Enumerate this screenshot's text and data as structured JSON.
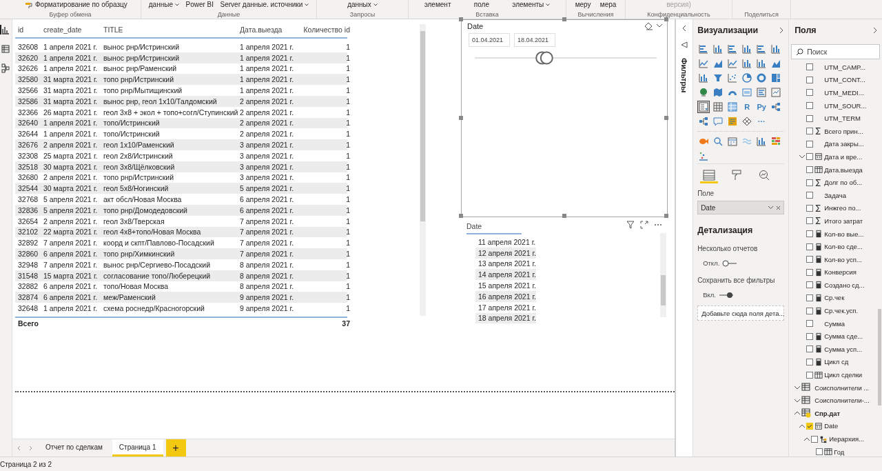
{
  "ribbon": {
    "groups": [
      {
        "label": "Буфер обмена",
        "items": [
          {
            "text": "Форматирование по образцу",
            "kind": "brush",
            "caret": false,
            "disabled": false
          }
        ]
      },
      {
        "label": "Данные",
        "items": [
          {
            "text": "данные",
            "kind": "text",
            "caret": true,
            "disabled": false
          },
          {
            "text": "Power BI",
            "kind": "text",
            "caret": false,
            "disabled": false
          },
          {
            "text": "Server данные. источники",
            "kind": "text",
            "caret": true,
            "disabled": false
          }
        ]
      },
      {
        "label": "Запросы",
        "items": [
          {
            "text": "данных",
            "kind": "text",
            "caret": true,
            "disabled": false
          }
        ]
      },
      {
        "label": "Вставка",
        "items": [
          {
            "text": "элемент",
            "kind": "text",
            "caret": false,
            "disabled": false
          },
          {
            "text": "поле",
            "kind": "text",
            "caret": false,
            "disabled": false
          },
          {
            "text": "элементы",
            "kind": "text",
            "caret": true,
            "disabled": false
          }
        ]
      },
      {
        "label": "Вычисления",
        "items": [
          {
            "text": "меру",
            "kind": "text",
            "caret": false,
            "disabled": false
          },
          {
            "text": "мера",
            "kind": "text",
            "caret": false,
            "disabled": false
          }
        ]
      },
      {
        "label": "Конфиденциальность",
        "items": [
          {
            "text": "версия)",
            "kind": "text",
            "caret": false,
            "disabled": true
          }
        ]
      },
      {
        "label": "Поделиться"
      }
    ]
  },
  "views": [
    {
      "kind": "report",
      "selected": true
    },
    {
      "kind": "data",
      "selected": false
    },
    {
      "kind": "model",
      "selected": false
    }
  ],
  "table": {
    "columns": [
      "id",
      "create_date",
      "TITLE",
      "Дата.выезда",
      "Количество id"
    ],
    "rows": [
      [
        "32608",
        "1 апреля 2021 г.",
        "вынос рнр/Истринский",
        "1 апреля 2021 г.",
        "1"
      ],
      [
        "32620",
        "1 апреля 2021 г.",
        "вынос рнр/Истринский",
        "1 апреля 2021 г.",
        "1"
      ],
      [
        "32626",
        "1 апреля 2021 г.",
        "вынос рнр/Раменский",
        "1 апреля 2021 г.",
        "1"
      ],
      [
        "32580",
        "31 марта 2021 г.",
        "топо рнр/Истринский",
        "1 апреля 2021 г.",
        "1"
      ],
      [
        "32566",
        "31 марта 2021 г.",
        "топо рнр/Мытищинский",
        "1 апреля 2021 г.",
        "1"
      ],
      [
        "32586",
        "31 марта 2021 г.",
        "вынос рнр, геол 1х10/Талдомский",
        "2 апреля 2021 г.",
        "1"
      ],
      [
        "32366",
        "26 марта 2021 г.",
        "геол 3х8 + экол + топо+согл/Ступинский",
        "2 апреля 2021 г.",
        "1"
      ],
      [
        "32640",
        "1 апреля 2021 г.",
        "топо/Истринский",
        "2 апреля 2021 г.",
        "1"
      ],
      [
        "32644",
        "1 апреля 2021 г.",
        "топо/Истринский",
        "2 апреля 2021 г.",
        "1"
      ],
      [
        "32676",
        "2 апреля 2021 г.",
        "геол 1х10/Раменский",
        "3 апреля 2021 г.",
        "1"
      ],
      [
        "32308",
        "25 марта 2021 г.",
        "геол 2х8/Истринский",
        "3 апреля 2021 г.",
        "1"
      ],
      [
        "32518",
        "30 марта 2021 г.",
        "геол 3х8/Щёлковский",
        "3 апреля 2021 г.",
        "1"
      ],
      [
        "32680",
        "2 апреля 2021 г.",
        "топо рнр/Истринский",
        "3 апреля 2021 г.",
        "1"
      ],
      [
        "32544",
        "30 марта 2021 г.",
        "геол 5х8/Ногинский",
        "5 апреля 2021 г.",
        "1"
      ],
      [
        "32768",
        "5 апреля 2021 г.",
        "акт обсл/Новая Москва",
        "6 апреля 2021 г.",
        "1"
      ],
      [
        "32836",
        "5 апреля 2021 г.",
        "топо рнр/Домодедовский",
        "6 апреля 2021 г.",
        "1"
      ],
      [
        "32654",
        "2 апреля 2021 г.",
        "геол 3х8/Тверская",
        "7 апреля 2021 г.",
        "1"
      ],
      [
        "32102",
        "22 марта 2021 г.",
        "геол 4х8+топо/Новая Москва",
        "7 апреля 2021 г.",
        "1"
      ],
      [
        "32892",
        "7 апреля 2021 г.",
        "коорд и скпт/Павлово-Посадский",
        "7 апреля 2021 г.",
        "1"
      ],
      [
        "32860",
        "6 апреля 2021 г.",
        "топо рнр/Химкинский",
        "7 апреля 2021 г.",
        "1"
      ],
      [
        "32948",
        "7 апреля 2021 г.",
        "вынос рнр/Сергиево-Посадский",
        "8 апреля 2021 г.",
        "1"
      ],
      [
        "31548",
        "15 марта 2021 г.",
        "согласование топо/Люберецкий",
        "8 апреля 2021 г.",
        "1"
      ],
      [
        "32882",
        "6 апреля 2021 г.",
        "топо/Новая Москва",
        "8 апреля 2021 г.",
        "1"
      ],
      [
        "32874",
        "6 апреля 2021 г.",
        "меж/Раменский",
        "9 апреля 2021 г.",
        "1"
      ],
      [
        "32648",
        "1 апреля 2021 г.",
        "схема роснедр/Красногорский",
        "9 апреля 2021 г.",
        "1"
      ]
    ],
    "total_label": "Всего",
    "total_value": "37"
  },
  "slicer": {
    "title": "Date",
    "from": "01.04.2021",
    "to": "18.04.2021",
    "thumbs": [
      {
        "level": 0.37
      },
      {
        "level": 0.395
      }
    ]
  },
  "date_table": {
    "header": "Date",
    "rows": [
      "11 апреля 2021 г.",
      "12 апреля 2021 г.",
      "13 апреля 2021 г.",
      "14 апреля 2021 г.",
      "15 апреля 2021 г.",
      "16 апреля 2021 г.",
      "17 апреля 2021 г.",
      "18 апреля 2021 г."
    ]
  },
  "page_tabs": [
    {
      "label": "Отчет по сделкам",
      "selected": false
    },
    {
      "label": "Страница 1",
      "selected": true
    }
  ],
  "add_page": "+",
  "status_bar": "Страница 2 из 2",
  "filters_pane": {
    "title": "Фильтры"
  },
  "visualizations": {
    "title": "Визуализации",
    "types": [
      {
        "kind": "hbar",
        "selected": false
      },
      {
        "kind": "column",
        "selected": false
      },
      {
        "kind": "hbar",
        "selected": false
      },
      {
        "kind": "column",
        "selected": false
      },
      {
        "kind": "hbar",
        "selected": false
      },
      {
        "kind": "column",
        "selected": false
      },
      {
        "kind": "line",
        "selected": false
      },
      {
        "kind": "area",
        "selected": false
      },
      {
        "kind": "line",
        "selected": false
      },
      {
        "kind": "column",
        "selected": false
      },
      {
        "kind": "column",
        "selected": false
      },
      {
        "kind": "area",
        "selected": false
      },
      {
        "kind": "column",
        "selected": false
      },
      {
        "kind": "funnel",
        "selected": false
      },
      {
        "kind": "scatter",
        "selected": false
      },
      {
        "kind": "pie",
        "selected": false
      },
      {
        "kind": "donut",
        "selected": false
      },
      {
        "kind": "treemap",
        "selected": false
      },
      {
        "kind": "globe",
        "selected": false
      },
      {
        "kind": "map",
        "selected": false
      },
      {
        "kind": "gauge",
        "selected": false
      },
      {
        "kind": "card",
        "selected": false
      },
      {
        "kind": "list",
        "selected": false
      },
      {
        "kind": "kpi",
        "selected": false
      },
      {
        "kind": "slicer",
        "selected": true
      },
      {
        "kind": "table",
        "selected": false
      },
      {
        "kind": "matrix",
        "selected": false
      },
      {
        "kind": "text",
        "text": "R",
        "selected": false
      },
      {
        "kind": "text",
        "text": "Py",
        "selected": false
      },
      {
        "kind": "tree",
        "selected": false
      },
      {
        "kind": "tree",
        "selected": false
      },
      {
        "kind": "bubble",
        "selected": false
      },
      {
        "kind": "document",
        "selected": false
      },
      {
        "kind": "diamond",
        "selected": false
      },
      {
        "kind": "text",
        "text": "···",
        "selected": false
      }
    ],
    "custom": [
      {
        "kind": "fish"
      },
      {
        "kind": "search"
      },
      {
        "kind": "calendar"
      },
      {
        "kind": "wave"
      },
      {
        "kind": "column"
      },
      {
        "kind": "heatmap"
      },
      {
        "kind": "dots"
      }
    ],
    "tabs": [
      {
        "kind": "fields",
        "selected": true
      },
      {
        "kind": "format",
        "selected": false
      },
      {
        "kind": "analytics",
        "selected": false
      }
    ],
    "well_label": "Поле",
    "well_value": "Date",
    "drill_title": "Детализация",
    "toggles": [
      {
        "label": "Несколько отчетов",
        "state_text": "Откл.",
        "on": false
      },
      {
        "label": "Сохранить все фильтры",
        "state_text": "Вкл.",
        "on": true
      }
    ],
    "drop_hint": "Добавьте сюда поля дета..."
  },
  "fields": {
    "title": "Поля",
    "search_placeholder": "Поиск",
    "items": [
      {
        "name": "UTM_CAMP...",
        "kind": "plain",
        "checked": false
      },
      {
        "name": "UTM_CONT...",
        "kind": "plain",
        "checked": false
      },
      {
        "name": "UTM_MEDI...",
        "kind": "plain",
        "checked": false
      },
      {
        "name": "UTM_SOUR...",
        "kind": "plain",
        "checked": false
      },
      {
        "name": "UTM_TERM",
        "kind": "plain",
        "checked": false
      },
      {
        "name": "Всего прин...",
        "kind": "sigma",
        "checked": false
      },
      {
        "name": "Дата закры...",
        "kind": "plain",
        "checked": false
      },
      {
        "name": "Дата и вре...",
        "kind": "calendar",
        "checked": false,
        "expanded": false
      },
      {
        "name": "Дата.выезда",
        "kind": "datetable",
        "checked": false
      },
      {
        "name": "Долг по об...",
        "kind": "sigma",
        "checked": false
      },
      {
        "name": "Задача",
        "kind": "plain",
        "checked": false
      },
      {
        "name": "Инжгео по...",
        "kind": "sigma",
        "checked": false
      },
      {
        "name": "Итого затрат",
        "kind": "sigma",
        "checked": false
      },
      {
        "name": "Кол-во вые...",
        "kind": "calc",
        "checked": false
      },
      {
        "name": "Кол-во сде...",
        "kind": "calc",
        "checked": false
      },
      {
        "name": "Кол-во усп...",
        "kind": "calc",
        "checked": false
      },
      {
        "name": "Конверсия",
        "kind": "calc",
        "checked": false
      },
      {
        "name": "Создано сд...",
        "kind": "calc",
        "checked": false
      },
      {
        "name": "Ср.чек",
        "kind": "calc",
        "checked": false
      },
      {
        "name": "Ср.чек.усп.",
        "kind": "calc",
        "checked": false
      },
      {
        "name": "Сумма",
        "kind": "plain",
        "checked": false
      },
      {
        "name": "Сумма сде...",
        "kind": "calc",
        "checked": false
      },
      {
        "name": "Сумма усп...",
        "kind": "calc",
        "checked": false
      },
      {
        "name": "Цикл сд",
        "kind": "calc",
        "checked": false
      },
      {
        "name": "Цикл сделки",
        "kind": "datetable",
        "checked": false
      }
    ],
    "tables": [
      {
        "name": "Соисполнители ...",
        "expanded": false,
        "in_use": false
      },
      {
        "name": "Соисполнители-...",
        "expanded": false,
        "in_use": false
      },
      {
        "name": "Спр.дат",
        "expanded": true,
        "in_use": true,
        "children": [
          {
            "name": "Date",
            "kind": "calendar",
            "checked": true,
            "expanded": true,
            "children": [
              {
                "name": "Иерархия...",
                "kind": "hierarchy",
                "checked": false,
                "expanded": true,
                "children": [
                  {
                    "name": "Год",
                    "kind": "datetable",
                    "checked": false
                  }
                ]
              }
            ]
          }
        ]
      }
    ]
  }
}
